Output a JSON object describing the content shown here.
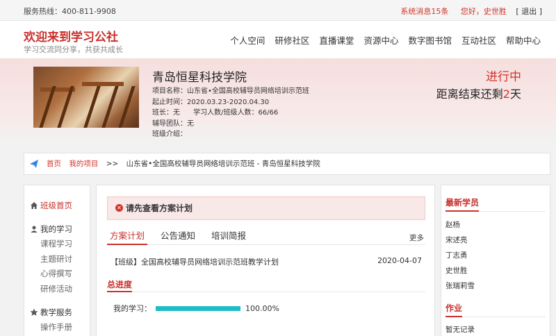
{
  "topbar": {
    "hotline": "服务热线：400-811-9908",
    "messages": "系统消息15条",
    "greeting": "您好，史世胜",
    "logout": "[ 退出 ]"
  },
  "header": {
    "brand": "欢迎来到学习公社",
    "slogan": "学习交流同分享，共获共成长",
    "nav": [
      "个人空间",
      "研修社区",
      "直播课堂",
      "资源中心",
      "数字图书馆",
      "互动社区",
      "帮助中心"
    ]
  },
  "banner": {
    "school": "青岛恒星科技学院",
    "project": "项目名称：山东省•全国高校辅导员网络培训示范班",
    "period": "起止时间：2020.03.23-2020.04.30",
    "monitor": "班长：无      学习人数/班级人数：66/66",
    "team": "辅导团队：无",
    "intro": "班级介绍：",
    "status": "进行中",
    "countdown_pre": "距离结束还剩",
    "countdown_num": "2",
    "countdown_post": "天"
  },
  "breadcrumb": {
    "home": "首页",
    "projects": "我的项目",
    "sep": ">>",
    "current": "山东省•全国高校辅导员网络培训示范班 - 青岛恒星科技学院"
  },
  "sidebar": {
    "home": "班级首页",
    "study_title": "我的学习",
    "study_items": [
      "课程学习",
      "主题研讨",
      "心得撰写",
      "研修活动"
    ],
    "service_title": "教学服务",
    "service_items": [
      "操作手册"
    ]
  },
  "main": {
    "alert": "请先查看方案计划",
    "tabs": [
      "方案计划",
      "公告通知",
      "培训简报"
    ],
    "more": "更多",
    "plan_title": "【班级】全国高校辅导员网络培训示范班教学计划",
    "plan_date": "2020-04-07",
    "progress_title": "总进度",
    "progress_label": "我的学习：",
    "progress_value": 1.0,
    "progress_text": "100.00%"
  },
  "right": {
    "students_title": "最新学员",
    "students": [
      "赵杨",
      "宋述亮",
      "丁志勇",
      "史世胜",
      "张瑞莉雪"
    ],
    "homework_title": "作业",
    "homework_empty": "暂无记录"
  },
  "colors": {
    "accent": "#c9302c",
    "progress": "#1fbcc8"
  }
}
